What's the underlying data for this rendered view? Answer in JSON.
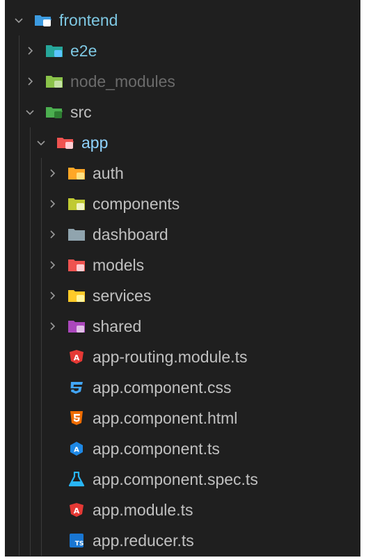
{
  "tree": [
    {
      "label": "frontend",
      "depth": 0,
      "kind": "folder",
      "expanded": true,
      "icon": "folder-frontend-icon",
      "color": "#3c9be0",
      "badge": "#ffffff",
      "style": "active"
    },
    {
      "label": "e2e",
      "depth": 1,
      "kind": "folder",
      "expanded": false,
      "icon": "folder-e2e-icon",
      "color": "#26a69a",
      "badge": "#5cc3ff",
      "style": "active"
    },
    {
      "label": "node_modules",
      "depth": 1,
      "kind": "folder",
      "expanded": false,
      "icon": "folder-node-icon",
      "color": "#8bc34a",
      "badge": "#c5e1a5",
      "style": "dim"
    },
    {
      "label": "src",
      "depth": 1,
      "kind": "folder",
      "expanded": true,
      "icon": "folder-src-icon",
      "color": "#4caf50",
      "badge": "#2e7d32",
      "style": "normal"
    },
    {
      "label": "app",
      "depth": 2,
      "kind": "folder",
      "expanded": true,
      "icon": "folder-app-icon",
      "color": "#ef5350",
      "badge": "#ffcdd2",
      "style": "selected"
    },
    {
      "label": "auth",
      "depth": 3,
      "kind": "folder",
      "expanded": false,
      "icon": "folder-auth-icon",
      "color": "#ffa726",
      "badge": "#ffe082",
      "style": "normal"
    },
    {
      "label": "components",
      "depth": 3,
      "kind": "folder",
      "expanded": false,
      "icon": "folder-components-icon",
      "color": "#c0ca33",
      "badge": "#f0f4c3",
      "style": "normal"
    },
    {
      "label": "dashboard",
      "depth": 3,
      "kind": "folder",
      "expanded": false,
      "icon": "folder-icon",
      "color": "#90a4ae",
      "badge": "",
      "style": "normal"
    },
    {
      "label": "models",
      "depth": 3,
      "kind": "folder",
      "expanded": false,
      "icon": "folder-models-icon",
      "color": "#ef5350",
      "badge": "#ffcdd2",
      "style": "normal"
    },
    {
      "label": "services",
      "depth": 3,
      "kind": "folder",
      "expanded": false,
      "icon": "folder-services-icon",
      "color": "#ffca28",
      "badge": "#fff59d",
      "style": "normal"
    },
    {
      "label": "shared",
      "depth": 3,
      "kind": "folder",
      "expanded": false,
      "icon": "folder-shared-icon",
      "color": "#ab47bc",
      "badge": "#e1bee7",
      "style": "normal"
    },
    {
      "label": "app-routing.module.ts",
      "depth": 3,
      "kind": "file",
      "icon": "angular-icon",
      "color": "#e53935",
      "style": "normal"
    },
    {
      "label": "app.component.css",
      "depth": 3,
      "kind": "file",
      "icon": "css-icon",
      "color": "#42a5f5",
      "style": "normal"
    },
    {
      "label": "app.component.html",
      "depth": 3,
      "kind": "file",
      "icon": "html-icon",
      "color": "#ef6c00",
      "style": "normal"
    },
    {
      "label": "app.component.ts",
      "depth": 3,
      "kind": "file",
      "icon": "angular-component-icon",
      "color": "#1e88e5",
      "style": "normal"
    },
    {
      "label": "app.component.spec.ts",
      "depth": 3,
      "kind": "file",
      "icon": "test-flask-icon",
      "color": "#29b6f6",
      "style": "normal"
    },
    {
      "label": "app.module.ts",
      "depth": 3,
      "kind": "file",
      "icon": "angular-icon",
      "color": "#e53935",
      "style": "normal"
    },
    {
      "label": "app.reducer.ts",
      "depth": 3,
      "kind": "file",
      "icon": "typescript-icon",
      "color": "#1976d2",
      "style": "normal"
    }
  ]
}
